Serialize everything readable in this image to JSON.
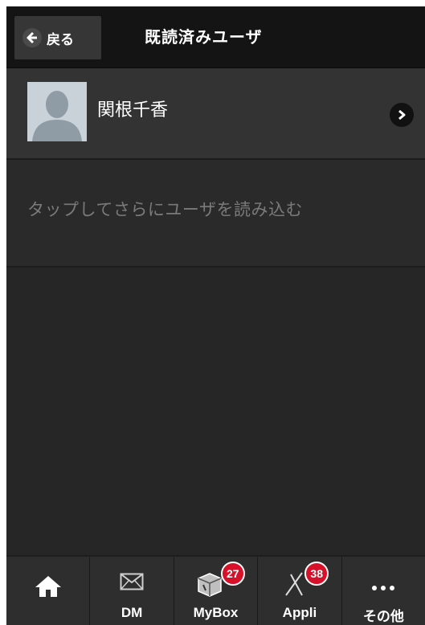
{
  "header": {
    "back_label": "戻る",
    "title": "既読済みユーザ"
  },
  "users": [
    {
      "name": "関根千香"
    }
  ],
  "load_more_label": "タップしてさらにユーザを読み込む",
  "nav": {
    "home_icon": "home-icon",
    "dm_label": "DM",
    "mybox_label": "MyBox",
    "mybox_badge": "27",
    "appli_label": "Appli",
    "appli_badge": "38",
    "more_label": "その他"
  },
  "colors": {
    "header_bg": "#141414",
    "content_bg": "#262626",
    "row_bg": "#333333",
    "badge": "#d8112a"
  }
}
